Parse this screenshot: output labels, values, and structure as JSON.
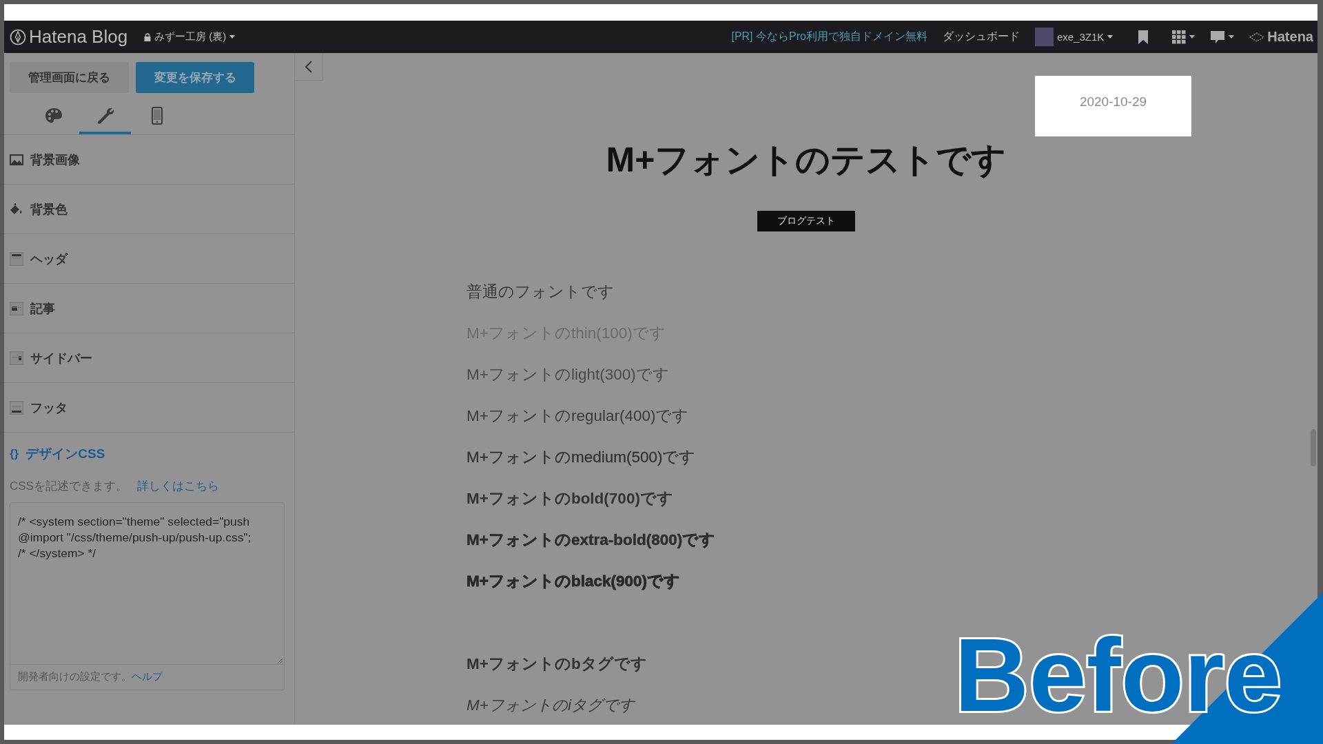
{
  "topbar": {
    "logo": "Hatena Blog",
    "blog_name": "みずー工房 (裏)",
    "promo_link": "[PR] 今ならPro利用で独自ドメイン無料",
    "dashboard_link": "ダッシュボード",
    "user": "exe_3Z1K",
    "brand": "Hatena"
  },
  "sidebar": {
    "back_button": "管理画面に戻る",
    "save_button": "変更を保存する",
    "tabs": [
      {
        "selected": false
      },
      {
        "selected": true
      },
      {
        "selected": false
      }
    ],
    "items": [
      "背景画像",
      "背景色",
      "ヘッダ",
      "記事",
      "サイドバー",
      "フッタ"
    ],
    "css_section": {
      "heading_icon": "{}",
      "heading": "デザインCSS",
      "description": "CSSを記述できます。",
      "more_link": "詳しくはこちら",
      "editor_value": "/* <system section=\"theme\" selected=\"push\n@import \"/css/theme/push-up/push-up.css\";\n/* </system> */",
      "note": "開発者向けの設定です。",
      "help_link": "ヘルプ"
    }
  },
  "article": {
    "date": "2020-10-29",
    "title": "M+フォントのテストです",
    "category": "ブログテスト",
    "lines": [
      {
        "kind": "normal",
        "text": "普通のフォントです"
      },
      {
        "kind": "thin",
        "text": "M+フォントのthin(100)です"
      },
      {
        "kind": "light",
        "text": "M+フォントのlight(300)です"
      },
      {
        "kind": "regular",
        "text": "M+フォントのregular(400)です"
      },
      {
        "kind": "medium",
        "text": "M+フォントのmedium(500)です"
      },
      {
        "kind": "bold",
        "text": "M+フォントのbold(700)です"
      },
      {
        "kind": "extrabold",
        "text": "M+フォントのextra-bold(800)です"
      },
      {
        "kind": "black",
        "text": "M+フォントのblack(900)です"
      },
      {
        "kind": "spacer"
      },
      {
        "kind": "btag",
        "text": "M+フォントのbタグです"
      },
      {
        "kind": "itag",
        "text": "M+フォントのiタグです"
      }
    ]
  },
  "overlay_label": "Before"
}
